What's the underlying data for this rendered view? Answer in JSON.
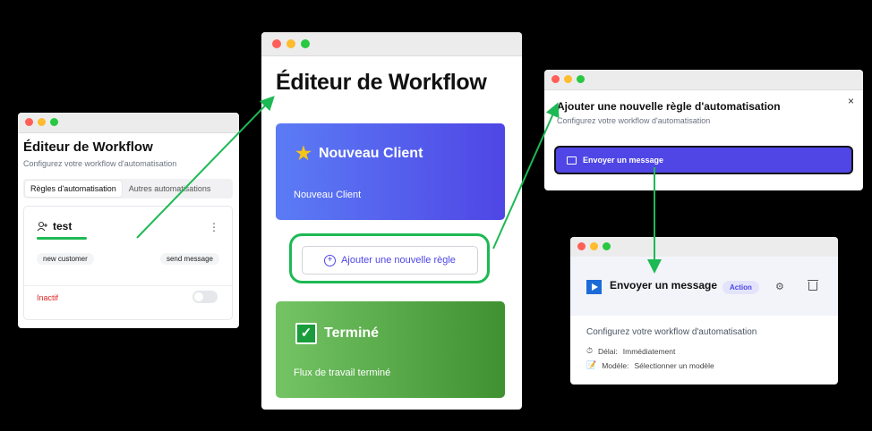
{
  "left_panel": {
    "title": "Éditeur de Workflow",
    "subtitle": "Configurez votre workflow d'automatisation",
    "tabs": [
      {
        "label": "Règles d'automatisation"
      },
      {
        "label": "Autres automatisations"
      }
    ],
    "rule": {
      "name": "test",
      "trigger": "new customer",
      "action": "send message",
      "status": "Inactif"
    }
  },
  "center_panel": {
    "title": "Éditeur de Workflow",
    "start_card": {
      "title": "Nouveau Client",
      "subtitle": "Nouveau Client"
    },
    "add_button": "Ajouter une nouvelle règle",
    "end_card": {
      "title": "Terminé",
      "subtitle": "Flux de travail terminé"
    }
  },
  "dialog": {
    "title": "Ajouter une nouvelle règle d'automatisation",
    "subtitle": "Configurez votre workflow d'automatisation",
    "close": "×",
    "option": "Envoyer un message"
  },
  "action_panel": {
    "title": "Envoyer un message",
    "badge": "Action",
    "subtitle": "Configurez votre workflow d'automatisation",
    "delay_label": "Délai:",
    "delay_value": "Immédiatement",
    "model_label": "Modèle:",
    "model_value": "Sélectionner un modèle"
  },
  "icons": {
    "user_plus": "user-plus-icon",
    "kebab": "more-vertical-icon",
    "star": "star-icon",
    "check": "check-box-icon",
    "plus": "plus-circle-icon",
    "message": "message-icon",
    "play": "play-icon",
    "gear": "gear-icon",
    "trash": "trash-icon",
    "timer": "timer-icon",
    "memo": "memo-icon"
  },
  "colors": {
    "accent": "#4f46e5",
    "green_highlight": "#1db954",
    "inactive": "#dc2626"
  }
}
